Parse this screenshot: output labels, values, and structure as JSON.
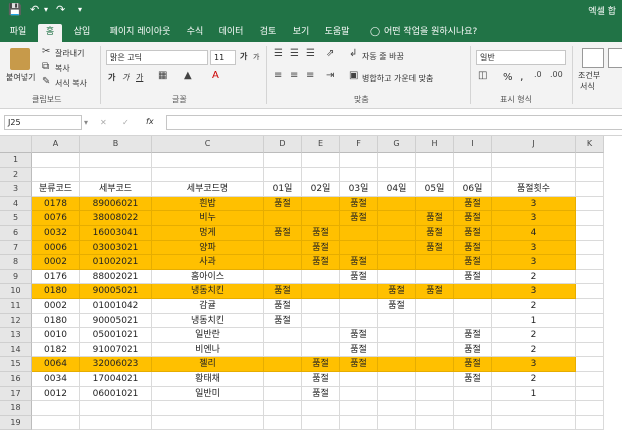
{
  "title": "엑셀 합",
  "quick_access": {
    "save_icon": "save-icon",
    "undo_icon": "undo-icon",
    "redo_icon": "redo-icon"
  },
  "tabs": [
    "파일",
    "홈",
    "삽입",
    "페이지 레이아웃",
    "수식",
    "데이터",
    "검토",
    "보기",
    "도움말"
  ],
  "active_tab": "홈",
  "tell_me": "어떤 작업을 원하시나요?",
  "ribbon": {
    "clipboard": {
      "paste": "붙여넣기",
      "cut": "잘라내기",
      "copy": "복사",
      "format_painter": "서식 복사",
      "group": "클립보드"
    },
    "font": {
      "name": "맑은 고딕",
      "size": "11",
      "bold": "가",
      "italic": "가",
      "underline": "가",
      "grow": "가",
      "shrink": "가",
      "group": "글꼴"
    },
    "alignment": {
      "wrap": "자동 줄 바꿈",
      "merge": "병합하고 가운데 맞춤",
      "group": "맞춤"
    },
    "number": {
      "format": "일반",
      "percent": "%",
      "comma": ",",
      "group": "표시 형식"
    },
    "styles": {
      "conditional": "조건부",
      "conditional2": "서식"
    }
  },
  "formula_bar": {
    "name_box": "J25",
    "cancel": "✕",
    "enter": "✓",
    "fx": "fx",
    "value": ""
  },
  "columns": [
    "A",
    "B",
    "C",
    "D",
    "E",
    "F",
    "G",
    "H",
    "I",
    "J",
    "K"
  ],
  "rows": [
    {
      "num": "1",
      "cells": [
        "",
        "",
        "",
        "",
        "",
        "",
        "",
        "",
        "",
        ""
      ],
      "hl": false
    },
    {
      "num": "2",
      "cells": [
        "",
        "",
        "",
        "",
        "",
        "",
        "",
        "",
        "",
        ""
      ],
      "hl": false
    },
    {
      "num": "3",
      "cells": [
        "분류코드",
        "세부코드",
        "세부코드명",
        "01일",
        "02일",
        "03일",
        "04일",
        "05일",
        "06일",
        "품절횟수"
      ],
      "hl": false
    },
    {
      "num": "4",
      "cells": [
        "0178",
        "89006021",
        "흰밥",
        "품절",
        "",
        "품절",
        "",
        "",
        "품절",
        "3"
      ],
      "hl": true
    },
    {
      "num": "5",
      "cells": [
        "0076",
        "38008022",
        "비누",
        "",
        "",
        "품절",
        "",
        "품절",
        "품절",
        "3"
      ],
      "hl": true
    },
    {
      "num": "6",
      "cells": [
        "0032",
        "16003041",
        "멍게",
        "품절",
        "품절",
        "",
        "",
        "품절",
        "품절",
        "4"
      ],
      "hl": true
    },
    {
      "num": "7",
      "cells": [
        "0006",
        "03003021",
        "양파",
        "",
        "품절",
        "",
        "",
        "품절",
        "품절",
        "3"
      ],
      "hl": true
    },
    {
      "num": "8",
      "cells": [
        "0002",
        "01002021",
        "사과",
        "",
        "품절",
        "품절",
        "",
        "",
        "품절",
        "3"
      ],
      "hl": true
    },
    {
      "num": "9",
      "cells": [
        "0176",
        "88002021",
        "홈아이스",
        "",
        "",
        "품절",
        "",
        "",
        "품절",
        "2"
      ],
      "hl": false
    },
    {
      "num": "10",
      "cells": [
        "0180",
        "90005021",
        "냉동치킨",
        "품절",
        "",
        "",
        "품절",
        "품절",
        "",
        "3"
      ],
      "hl": true
    },
    {
      "num": "11",
      "cells": [
        "0002",
        "01001042",
        "감귤",
        "품절",
        "",
        "",
        "품절",
        "",
        "",
        "2"
      ],
      "hl": false
    },
    {
      "num": "12",
      "cells": [
        "0180",
        "90005021",
        "냉동치킨",
        "품절",
        "",
        "",
        "",
        "",
        "",
        "1"
      ],
      "hl": false
    },
    {
      "num": "13",
      "cells": [
        "0010",
        "05001021",
        "일반란",
        "",
        "",
        "품절",
        "",
        "",
        "품절",
        "2"
      ],
      "hl": false
    },
    {
      "num": "14",
      "cells": [
        "0182",
        "91007021",
        "비엔나",
        "",
        "",
        "품절",
        "",
        "",
        "품절",
        "2"
      ],
      "hl": false
    },
    {
      "num": "15",
      "cells": [
        "0064",
        "32006023",
        "젤리",
        "",
        "품절",
        "품절",
        "",
        "",
        "품절",
        "3"
      ],
      "hl": true
    },
    {
      "num": "16",
      "cells": [
        "0034",
        "17004021",
        "황태채",
        "",
        "품절",
        "",
        "",
        "",
        "품절",
        "2"
      ],
      "hl": false
    },
    {
      "num": "17",
      "cells": [
        "0012",
        "06001021",
        "일반미",
        "",
        "품절",
        "",
        "",
        "",
        "",
        "1"
      ],
      "hl": false
    },
    {
      "num": "18",
      "cells": [
        "",
        "",
        "",
        "",
        "",
        "",
        "",
        "",
        "",
        ""
      ],
      "hl": false
    },
    {
      "num": "19",
      "cells": [
        "",
        "",
        "",
        "",
        "",
        "",
        "",
        "",
        "",
        ""
      ],
      "hl": false
    }
  ],
  "colors": {
    "excel_green": "#217346",
    "highlight": "#ffc000"
  }
}
